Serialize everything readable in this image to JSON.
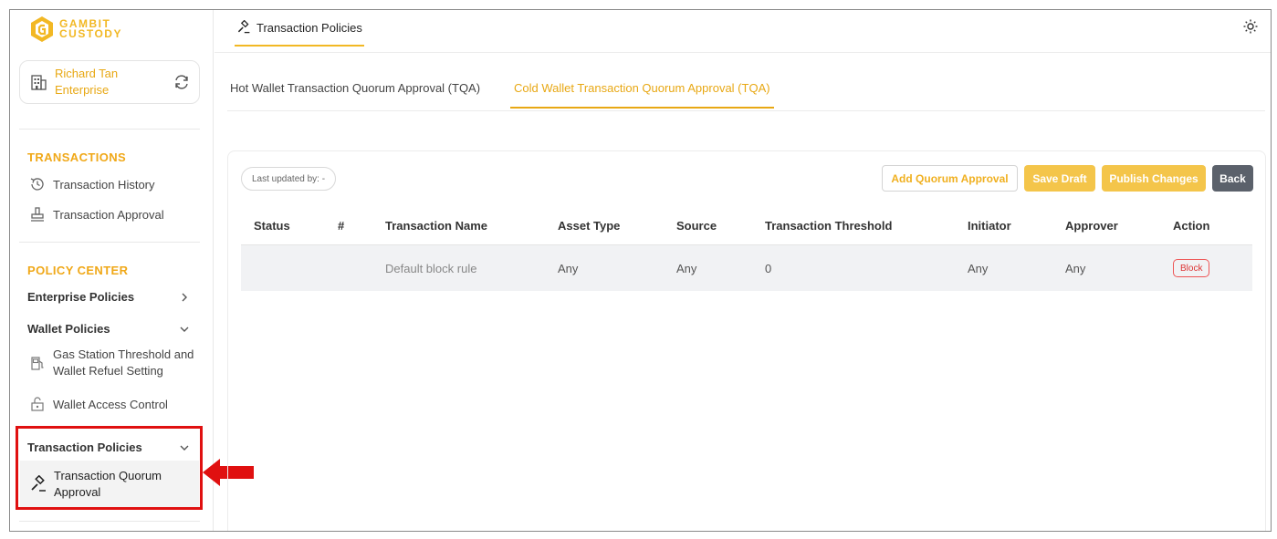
{
  "brand": {
    "line1": "GAMBIT",
    "line2": "CUSTODY",
    "color": "#F2B824"
  },
  "account": {
    "name_line1": "Richard Tan",
    "name_line2": "Enterprise"
  },
  "sidebar": {
    "transactions_title": "TRANSACTIONS",
    "transaction_history": "Transaction History",
    "transaction_approval": "Transaction Approval",
    "policy_center_title": "POLICY CENTER",
    "enterprise_policies": "Enterprise Policies",
    "wallet_policies": "Wallet Policies",
    "gas_station_line1": "Gas Station Threshold and",
    "gas_station_line2": "Wallet Refuel Setting",
    "wallet_access_control": "Wallet Access Control",
    "transaction_policies": "Transaction Policies",
    "tqa_line1": "Transaction Quorum",
    "tqa_line2": "Approval"
  },
  "header": {
    "tab_label": "Transaction Policies"
  },
  "subtabs": [
    {
      "label": "Hot Wallet Transaction Quorum Approval (TQA)",
      "active": false
    },
    {
      "label": "Cold Wallet Transaction Quorum Approval (TQA)",
      "active": true
    }
  ],
  "toolbar": {
    "last_updated": "Last updated by: -",
    "add_quorum": "Add Quorum Approval",
    "save_draft": "Save Draft",
    "publish": "Publish Changes",
    "back": "Back"
  },
  "table": {
    "columns": [
      "Status",
      "#",
      "Transaction Name",
      "Asset Type",
      "Source",
      "Transaction Threshold",
      "Initiator",
      "Approver",
      "Action"
    ],
    "rows": [
      {
        "status": "",
        "index": "",
        "name": "Default block rule",
        "asset_type": "Any",
        "source": "Any",
        "threshold": "0",
        "initiator": "Any",
        "approver": "Any",
        "action": "Block"
      }
    ]
  },
  "colors": {
    "accent": "#E8A814",
    "highlight": "#E01010",
    "back_button": "#5B616B"
  }
}
